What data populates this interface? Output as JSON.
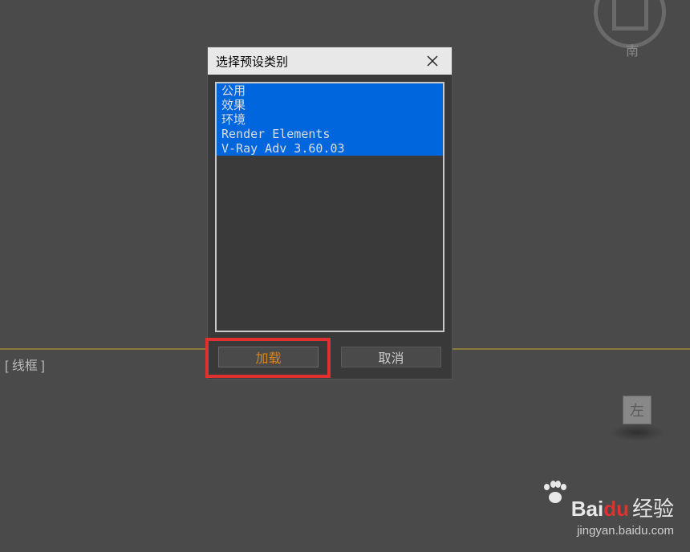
{
  "background": {
    "viewport_label": "[ 线框 ]",
    "compass_char": "南",
    "axis_label": "左"
  },
  "dialog": {
    "title": "选择预设类别",
    "items": [
      "公用",
      "效果",
      "环境",
      "Render Elements",
      "V-Ray Adv 3.60.03"
    ],
    "load_label": "加载",
    "cancel_label": "取消"
  },
  "watermark": {
    "brand_en_1": "Bai",
    "brand_en_2": "du",
    "brand_cn": "经验",
    "url": "jingyan.baidu.com"
  }
}
